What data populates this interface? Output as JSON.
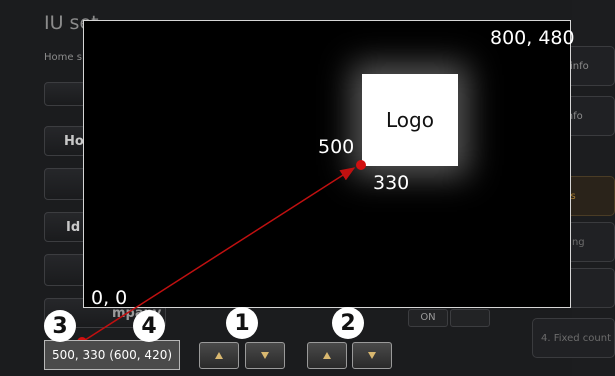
{
  "background": {
    "title": "IU set",
    "crumb": "Home s",
    "label_ho": "Ho",
    "label_id": "Id",
    "label_company": "mpany",
    "pill_on": "ON",
    "right_items": [
      "ntact info",
      "tem info",
      "ettings",
      "k setting",
      "ttable",
      "ers",
      "4. Fixed count"
    ]
  },
  "screen": {
    "top_right_coord": "800, 480",
    "bottom_left_coord": "0, 0",
    "logo_label": "Logo",
    "point_x": "500",
    "point_y": "330"
  },
  "controls": {
    "position_value": "500, 330 (600, 420)",
    "badge_1": "1",
    "badge_2": "2",
    "badge_3": "3",
    "badge_4": "4"
  },
  "colors": {
    "marker": "#d01010",
    "arrow_accent": "#d9b870"
  }
}
